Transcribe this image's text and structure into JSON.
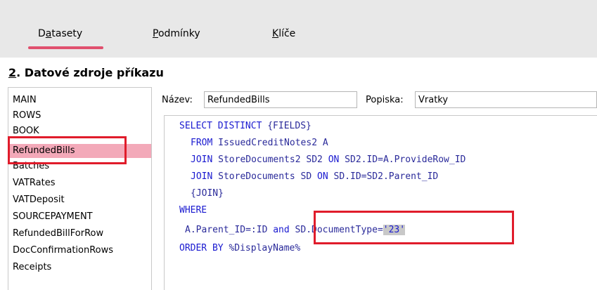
{
  "tabs": [
    {
      "label": "Datasety",
      "underline_char_index": 1
    },
    {
      "label": "Podmínky",
      "underline_char_index": 0
    },
    {
      "label": "Klíče",
      "underline_char_index": 0
    }
  ],
  "section": {
    "number": "2",
    "rest": ". Datové zdroje příkazu"
  },
  "datasets": {
    "items": [
      "MAIN",
      "ROWS",
      "BOOK",
      "RefundedBills",
      "Batches",
      "VATRates",
      "VATDeposit",
      "SOURCEPAYMENT",
      "RefundedBillForRow",
      "DocConfirmationRows",
      "Receipts"
    ],
    "selected": "RefundedBills"
  },
  "form": {
    "name_label": "Název:",
    "name_value": "RefundedBills",
    "desc_label": "Popiska:",
    "desc_value": "Vratky"
  },
  "sql": {
    "l1_kw": "SELECT DISTINCT",
    "l1_rest": " {FIELDS}",
    "l2_kw": "FROM",
    "l2_rest": " IssuedCreditNotes2 A",
    "l3_kw1": "JOIN",
    "l3_mid": " StoreDocuments2 SD2 ",
    "l3_kw2": "ON",
    "l3_rest": " SD2.ID=A.ProvideRow_ID",
    "l4_kw1": "JOIN",
    "l4_mid": " StoreDocuments SD ",
    "l4_kw2": "ON",
    "l4_rest": " SD.ID=SD2.Parent_ID",
    "l5": "{JOIN}",
    "l6_kw": "WHERE",
    "l7_a": "A.Parent_ID=:ID ",
    "l7_kw": "and",
    "l7_b": " SD.DocumentType=",
    "l7_str": "'23'",
    "l8_kw": "ORDER BY",
    "l8_rest": " %DisplayName%"
  },
  "colors": {
    "accent": "#e0506e",
    "highlight": "#e01c2b",
    "selection": "#f3a9b9",
    "keyword": "#1a1ad0"
  }
}
